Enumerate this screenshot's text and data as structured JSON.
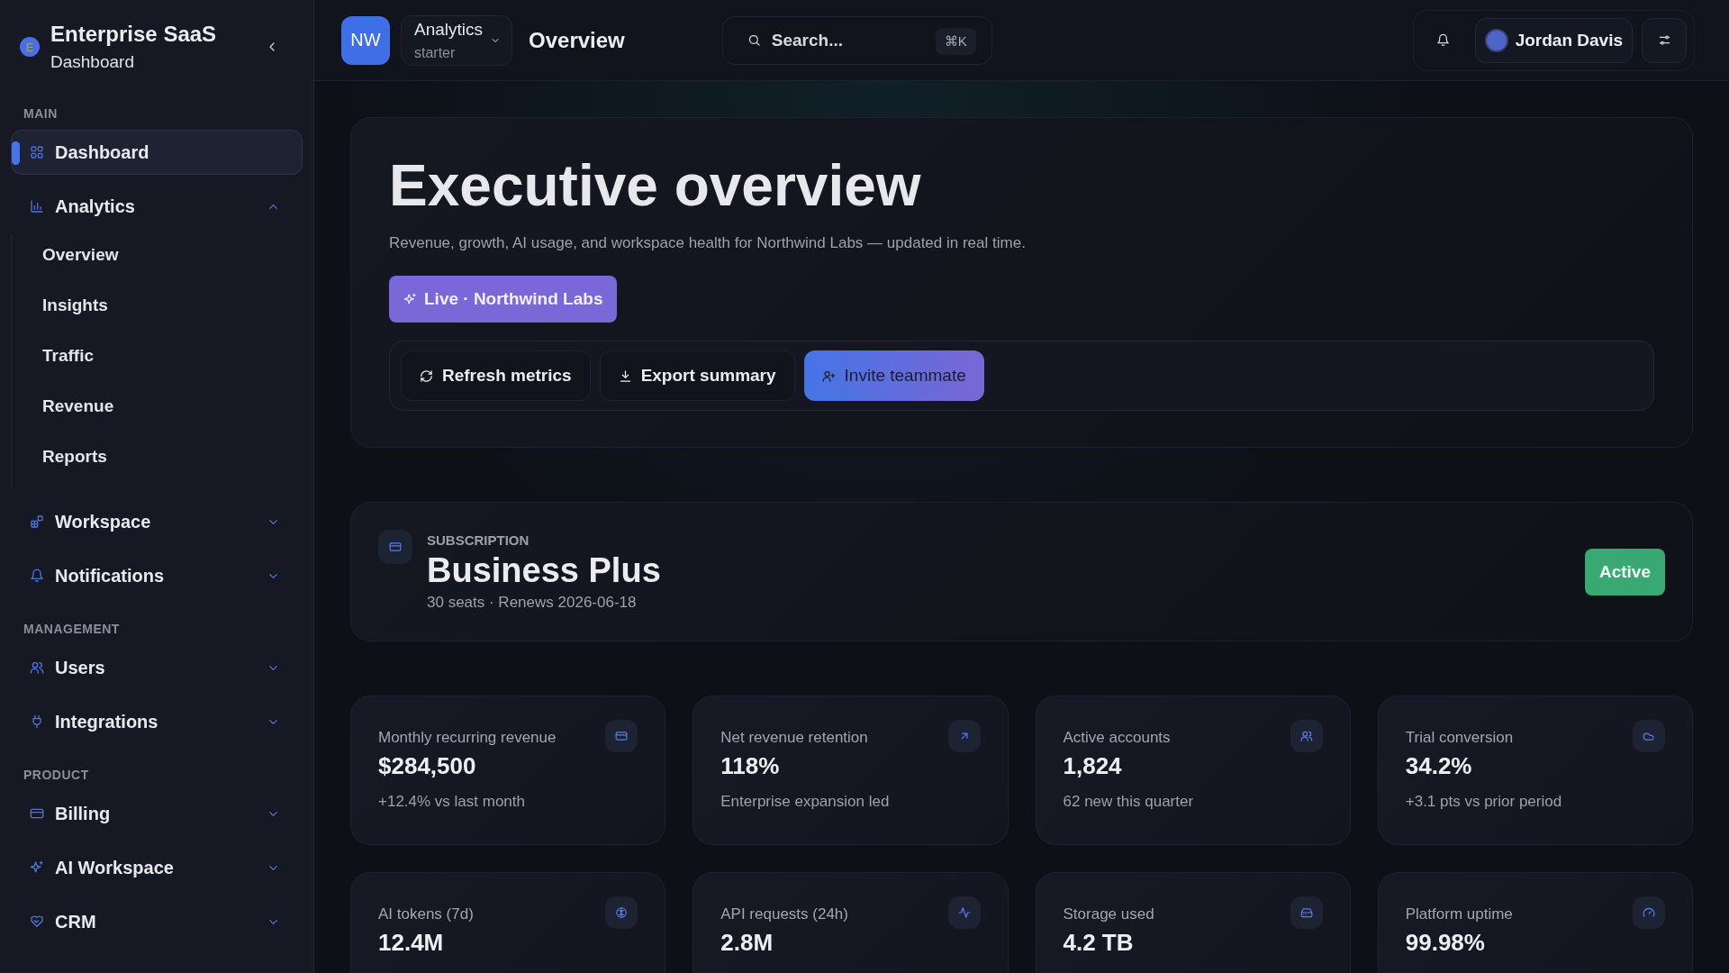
{
  "sidebar": {
    "brand": {
      "initial": "E",
      "title": "Enterprise SaaS",
      "subtitle": "Dashboard"
    },
    "sections": [
      {
        "label": "MAIN",
        "items": [
          {
            "label": "Dashboard",
            "selected": true
          },
          {
            "label": "Analytics",
            "selected": false,
            "expanded": true,
            "children": [
              {
                "label": "Overview",
                "selected": false
              },
              {
                "label": "Insights",
                "selected": false
              },
              {
                "label": "Traffic",
                "selected": false
              },
              {
                "label": "Revenue",
                "selected": false
              },
              {
                "label": "Reports",
                "selected": false
              }
            ]
          },
          {
            "label": "Workspace",
            "selected": false,
            "expanded": false
          },
          {
            "label": "Notifications",
            "selected": false,
            "expanded": false
          }
        ]
      },
      {
        "label": "MANAGEMENT",
        "items": [
          {
            "label": "Users",
            "selected": false,
            "expanded": false
          },
          {
            "label": "Integrations",
            "selected": false,
            "expanded": false
          }
        ]
      },
      {
        "label": "PRODUCT",
        "items": [
          {
            "label": "Billing",
            "selected": false,
            "expanded": false
          },
          {
            "label": "AI Workspace",
            "selected": false,
            "expanded": false
          },
          {
            "label": "CRM",
            "selected": false,
            "expanded": false
          }
        ]
      }
    ]
  },
  "header": {
    "workspace_avatar": "NW",
    "workspace": {
      "name": "Analytics",
      "plan": "starter"
    },
    "page_title": "Overview",
    "search": {
      "placeholder": "Search...",
      "shortcut": "⌘K"
    },
    "user": {
      "name": "Jordan Davis"
    }
  },
  "hero": {
    "title": "Executive overview",
    "subtitle": "Revenue, growth, AI usage, and workspace health for Northwind Labs — updated in real time.",
    "badge": "Live · Northwind Labs",
    "actions": [
      {
        "label": "Refresh metrics",
        "kind": "secondary"
      },
      {
        "label": "Export summary",
        "kind": "secondary"
      },
      {
        "label": "Invite teammate",
        "kind": "primary"
      }
    ]
  },
  "subscription": {
    "eyebrow": "SUBSCRIPTION",
    "plan": "Business Plus",
    "details": "30 seats · Renews 2026-06-18",
    "status": "Active"
  },
  "stats": [
    {
      "label": "Monthly recurring revenue",
      "value": "$284,500",
      "note": "+12.4% vs last month"
    },
    {
      "label": "Net revenue retention",
      "value": "118%",
      "note": "Enterprise expansion led"
    },
    {
      "label": "Active accounts",
      "value": "1,824",
      "note": "62 new this quarter"
    },
    {
      "label": "Trial conversion",
      "value": "34.2%",
      "note": "+3.1 pts vs prior period"
    },
    {
      "label": "AI tokens (7d)",
      "value": "12.4M"
    },
    {
      "label": "API requests (24h)",
      "value": "2.8M"
    },
    {
      "label": "Storage used",
      "value": "4.2 TB"
    },
    {
      "label": "Platform uptime",
      "value": "99.98%"
    }
  ]
}
